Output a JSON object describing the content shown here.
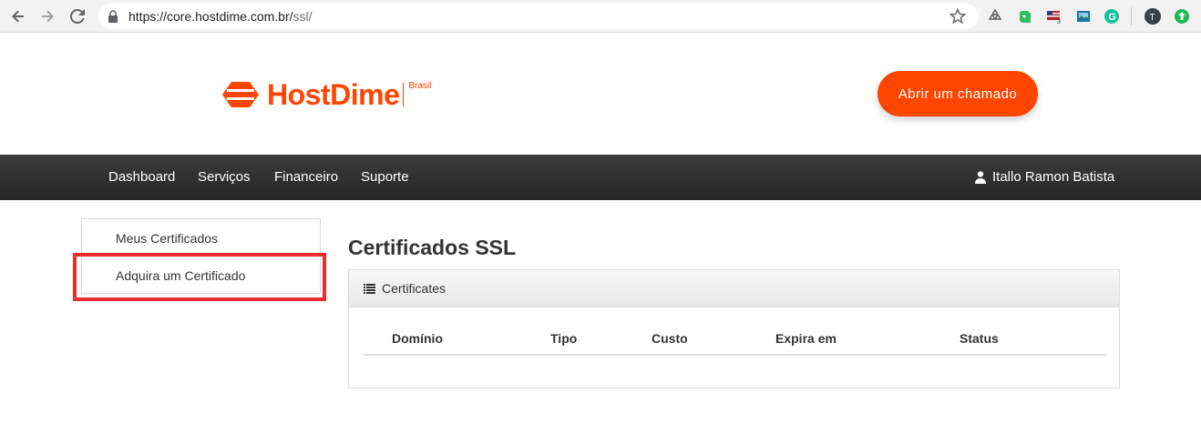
{
  "browser": {
    "url_host": "https://core.hostdime.com.br/",
    "url_path": "ssl/",
    "icons": [
      "back-arrow-icon",
      "forward-arrow-icon",
      "reload-icon",
      "lock-icon",
      "star-icon"
    ],
    "extensions": [
      {
        "name": "recycle-extension-icon",
        "color": "#5f6368"
      },
      {
        "name": "evernote-extension-icon",
        "color": "#2dbe60"
      },
      {
        "name": "flag-extension-icon",
        "color": "#3c5a99",
        "badge": "3"
      },
      {
        "name": "image-extension-icon",
        "color": "#1a73a8"
      },
      {
        "name": "grammarly-extension-icon",
        "color": "#15c39a"
      },
      {
        "name": "profile-avatar-icon",
        "color": "#3c4043",
        "letter": "T"
      },
      {
        "name": "upload-extension-icon",
        "color": "#1fb955"
      }
    ]
  },
  "header": {
    "logo_text": "HostDime",
    "logo_region": "Brasil",
    "cta_label": "Abrir um chamado",
    "brand_color": "#ff4500"
  },
  "nav": {
    "items": [
      {
        "label": "Dashboard"
      },
      {
        "label": "Serviços"
      },
      {
        "label": "Financeiro"
      },
      {
        "label": "Suporte"
      }
    ],
    "user_name": "Itallo Ramon Batista"
  },
  "sidebar": {
    "items": [
      {
        "label": "Meus Certificados"
      },
      {
        "label": "Adquira um Certificado",
        "highlighted": true
      }
    ]
  },
  "main": {
    "title": "Certificados SSL",
    "panel_title": "Certificates",
    "columns": [
      "Domínio",
      "Tipo",
      "Custo",
      "Expira em",
      "Status"
    ],
    "rows": []
  }
}
